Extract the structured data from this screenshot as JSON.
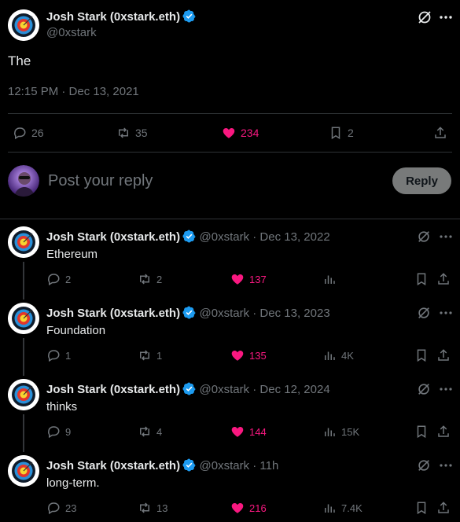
{
  "main_tweet": {
    "name": "Josh Stark (0xstark.eth)",
    "handle": "@0xstark",
    "text": "The",
    "timestamp": "12:15 PM · Dec 13, 2021",
    "replies": "26",
    "retweets": "35",
    "likes": "234",
    "bookmarks": "2"
  },
  "reply_box": {
    "placeholder": "Post your reply",
    "button_label": "Reply"
  },
  "replies": [
    {
      "name": "Josh Stark (0xstark.eth)",
      "meta": "@0xstark · Dec 13, 2022",
      "text": "Ethereum",
      "replies": "2",
      "retweets": "2",
      "likes": "137",
      "views": ""
    },
    {
      "name": "Josh Stark (0xstark.eth)",
      "meta": "@0xstark · Dec 13, 2023",
      "text": "Foundation",
      "replies": "1",
      "retweets": "1",
      "likes": "135",
      "views": "4K"
    },
    {
      "name": "Josh Stark (0xstark.eth)",
      "meta": "@0xstark · Dec 12, 2024",
      "text": "thinks",
      "replies": "9",
      "retweets": "4",
      "likes": "144",
      "views": "15K"
    },
    {
      "name": "Josh Stark (0xstark.eth)",
      "meta": "@0xstark · 11h",
      "text": "long-term.",
      "replies": "23",
      "retweets": "13",
      "likes": "216",
      "views": "7.4K"
    }
  ],
  "colors": {
    "background": "#000000",
    "text": "#e7e9ea",
    "muted": "#71767b",
    "like": "#f91880",
    "verified": "#1d9bf0",
    "divider": "#2f3336"
  },
  "icons": [
    "target-avatar-icon",
    "verified-badge-icon",
    "grok-slash-icon",
    "more-icon",
    "reply-icon",
    "retweet-icon",
    "heart-icon",
    "bookmark-icon",
    "share-icon",
    "views-icon"
  ]
}
